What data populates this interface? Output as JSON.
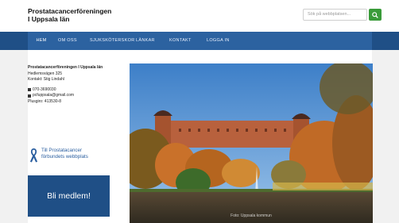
{
  "header": {
    "site_title": "Prostatacancerföreningen\nI Uppsala län",
    "search_placeholder": "Sök på webbplatsen..."
  },
  "nav": {
    "items": [
      "HEM",
      "OM OSS",
      "SJUKSKÖTERSKOR",
      "LÄNKAR",
      "KONTAKT",
      "LOGGA IN"
    ]
  },
  "sidebar": {
    "org_name": "Prostatacancerföreningen I Uppsala län",
    "address": "Hedlemsvägen 325",
    "contact_person": "Kontakt: Stig Lindahl",
    "phone": "070-3690030",
    "email": "pcfuppsala@gmail.com",
    "plusgiro": "Plusgiro: 413530-8",
    "ribbon_link": "Till Prostatacancer\nförbundets webbplats",
    "join_label": "Bli medlem!"
  },
  "photo": {
    "caption": "Foto: Uppsala kommun"
  },
  "colors": {
    "nav_dark": "#1f4f86",
    "nav": "#2c62a0",
    "search_button": "#3a9b3a",
    "ribbon": "#2b5fa0"
  }
}
